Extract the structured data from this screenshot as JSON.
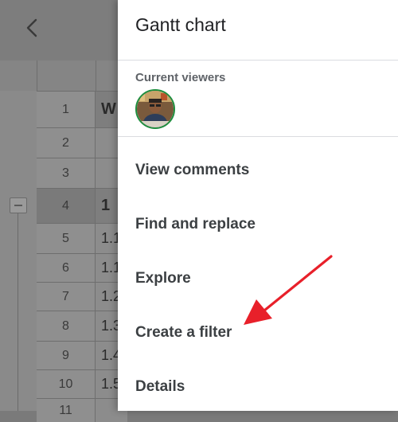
{
  "drawer": {
    "title": "Gantt chart",
    "viewers_label": "Current viewers",
    "menu": [
      {
        "label": "View comments"
      },
      {
        "label": "Find and replace"
      },
      {
        "label": "Explore"
      },
      {
        "label": "Create a filter"
      },
      {
        "label": "Details"
      }
    ]
  },
  "sheet": {
    "row_numbers": [
      "1",
      "2",
      "3",
      "4",
      "5",
      "6",
      "7",
      "8",
      "9",
      "10",
      "11"
    ],
    "cells": [
      "W",
      "",
      "",
      "1",
      "1.1",
      "1.1",
      "1.2",
      "1.3",
      "1.4",
      "1.5",
      ""
    ]
  },
  "colors": {
    "accent_arrow": "#e8202a",
    "avatar_ring": "#1e8e3e"
  },
  "icons": [
    "chevron-left-icon",
    "collapse-group-icon",
    "annotation-arrow"
  ]
}
